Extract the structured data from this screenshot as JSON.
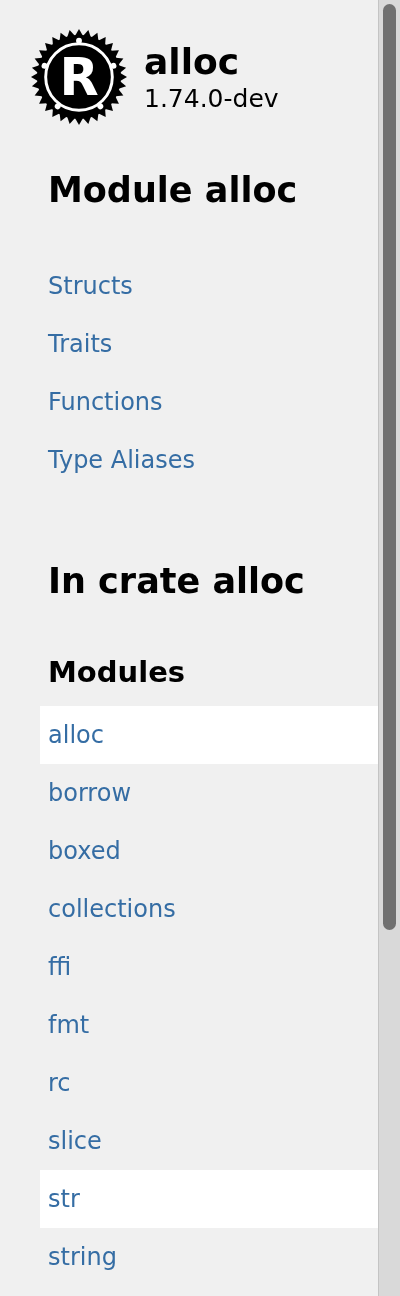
{
  "crate": {
    "logo_letter": "R",
    "name": "alloc",
    "version": "1.74.0-dev"
  },
  "module_section": {
    "title": "Module alloc",
    "links": [
      {
        "label": "Structs"
      },
      {
        "label": "Traits"
      },
      {
        "label": "Functions"
      },
      {
        "label": "Type Aliases"
      }
    ]
  },
  "crate_section": {
    "title": "In crate alloc",
    "subtitle": "Modules",
    "items": [
      {
        "label": "alloc",
        "selected": true
      },
      {
        "label": "borrow",
        "selected": false
      },
      {
        "label": "boxed",
        "selected": false
      },
      {
        "label": "collections",
        "selected": false
      },
      {
        "label": "ffi",
        "selected": false
      },
      {
        "label": "fmt",
        "selected": false
      },
      {
        "label": "rc",
        "selected": false
      },
      {
        "label": "slice",
        "selected": false
      },
      {
        "label": "str",
        "selected": true
      },
      {
        "label": "string",
        "selected": false
      }
    ]
  }
}
